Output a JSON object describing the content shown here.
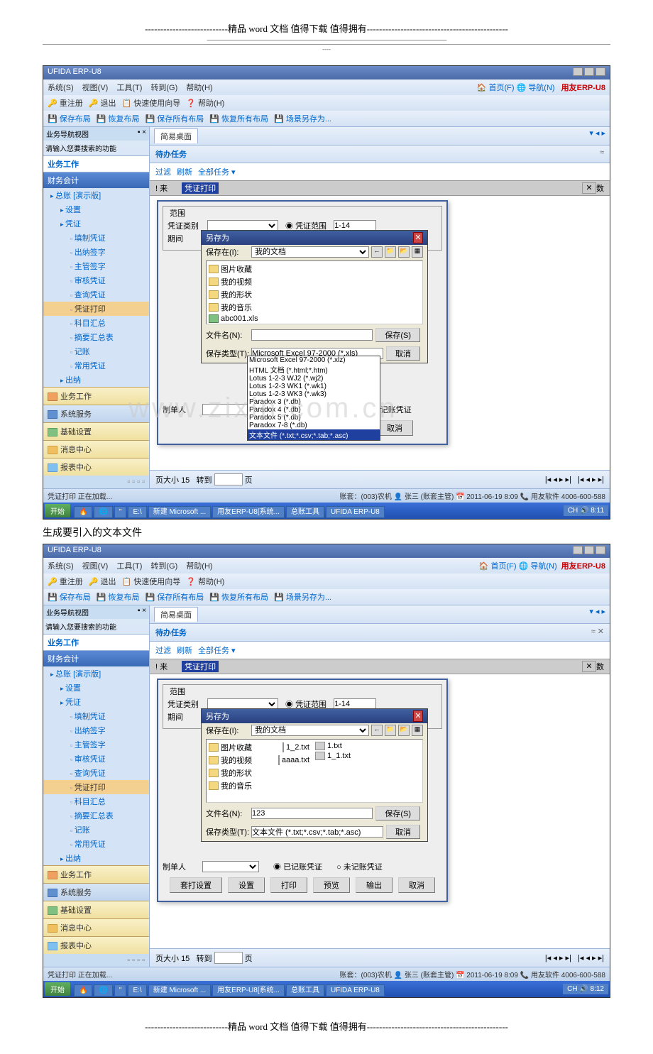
{
  "page_header": {
    "sep": "---------------------------精品 word 文档  值得下载  值得拥有----------------------------------------------",
    "dash": "-------------------------------------------------------------------------------------------------------------------------------------------------------------------------",
    "dash2": "----"
  },
  "caption": "生成要引入的文本文件",
  "watermark": "www.zixin.com.cn",
  "page_footer": {
    "sep": "---------------------------精品 word 文档  值得下载  值得拥有----------------------------------------------"
  },
  "erp": {
    "title": "UFIDA ERP-U8",
    "menu": [
      "系统(S)",
      "视图(V)",
      "工具(T)",
      "转到(G)",
      "帮助(H)"
    ],
    "menu_right": {
      "home": "首页(F)",
      "nav": "导航(N)",
      "logo": "用友ERP-U8"
    },
    "tb1": [
      "重注册",
      "退出",
      "快速使用向导",
      "帮助(H)"
    ],
    "tb2": [
      "保存布局",
      "恢复布局",
      "保存所有布局",
      "恢复所有布局",
      "场景另存为..."
    ],
    "side": {
      "nav_label": "业务导航视图",
      "search_hint": "请输入您要搜索的功能",
      "work": "业务工作",
      "group": "财务会计",
      "tree": [
        {
          "l": "l1",
          "t": "总账 [演示版]",
          "leaf": false
        },
        {
          "l": "l2",
          "t": "设置",
          "leaf": false
        },
        {
          "l": "l2",
          "t": "凭证",
          "leaf": false
        },
        {
          "l": "l3",
          "t": "填制凭证",
          "leaf": true
        },
        {
          "l": "l3",
          "t": "出纳签字",
          "leaf": true
        },
        {
          "l": "l3",
          "t": "主管签字",
          "leaf": true
        },
        {
          "l": "l3",
          "t": "审核凭证",
          "leaf": true
        },
        {
          "l": "l3",
          "t": "查询凭证",
          "leaf": true
        },
        {
          "l": "l3",
          "t": "凭证打印",
          "leaf": true,
          "sel": true
        },
        {
          "l": "l3",
          "t": "科目汇总",
          "leaf": true
        },
        {
          "l": "l3",
          "t": "摘要汇总表",
          "leaf": true
        },
        {
          "l": "l3",
          "t": "记账",
          "leaf": true
        },
        {
          "l": "l3",
          "t": "常用凭证",
          "leaf": true
        },
        {
          "l": "l2",
          "t": "出纳",
          "leaf": false
        }
      ],
      "cats": [
        "业务工作",
        "系统服务",
        "基础设置",
        "消息中心",
        "报表中心"
      ]
    },
    "tabs": {
      "main": "简易桌面"
    },
    "task": {
      "title": "待办任务",
      "btns": "≈",
      "filter": [
        "过滤",
        "刷新",
        "全部任务 ▾"
      ]
    },
    "row": {
      "c1": "! 来",
      "c2": "凭证打印",
      "c3": "数"
    },
    "pz_dlg": {
      "title": "凭证打印",
      "range": "范围",
      "type": "凭证类别",
      "range2": "凭证范围",
      "range2_val": "1-14",
      "period": "期间",
      "maker": "制单人",
      "recorded": "已记账凭证",
      "unrecorded": "未记账凭证",
      "btns": [
        "套打设置",
        "设置",
        "打印",
        "预览",
        "输出",
        "取消"
      ]
    },
    "save_dlg": {
      "title": "另存为",
      "in": "保存在(I):",
      "in_val": "我的文档",
      "files1": [
        {
          "i": "",
          "n": "图片收藏"
        },
        {
          "i": "",
          "n": "我的视频"
        },
        {
          "i": "",
          "n": "我的形状"
        },
        {
          "i": "",
          "n": "我的音乐"
        },
        {
          "i": "xls",
          "n": "abc001.xls"
        }
      ],
      "files2": [
        {
          "i": "",
          "n": "图片收藏",
          "n2": "1_2.txt"
        },
        {
          "i": "",
          "n": "我的视频",
          "n2": "aaaa.txt"
        },
        {
          "i": "",
          "n": "我的形状"
        },
        {
          "i": "",
          "n": "我的音乐"
        },
        {
          "i": "txt",
          "n": "1.txt"
        },
        {
          "i": "txt",
          "n": "1_1.txt"
        }
      ],
      "fname": "文件名(N):",
      "fname_val": "123",
      "ftype": "保存类型(T):",
      "ftype_val": "Microsoft Excel 97-2000 (*.xls)",
      "ftype_val2": "文本文件 (*.txt;*.csv;*.tab;*.asc)",
      "typelist": [
        "Microsoft Excel 97-2000 (*.xlz)",
        "HTML 文档 (*.html;*.htm)",
        "Lotus 1-2-3 WJ2 (*.wj2)",
        "Lotus 1-2-3 WK1 (*.wk1)",
        "Lotus 1-2-3 WK3 (*.wk3)",
        "Paradox 3 (*.db)",
        "Paradox 4 (*.db)",
        "Paradox 5 (*.db)",
        "Paradox 7-8 (*.db)",
        "文本文件 (*.txt;*.csv;*.tab;*.asc)"
      ],
      "save": "保存(S)",
      "cancel": "取消"
    },
    "page": {
      "size": "页大小",
      "size_v": "15",
      "goto": "转到",
      "page": "页"
    },
    "status": {
      "left": "凭证打印 正在加载...",
      "right": "账套：(003)农机 👤 张三 (账套主管) 📅 2011-06-19 8:09 📞 用友软件  4006-600-588"
    },
    "win": {
      "start": "开始",
      "items": [
        "🔥",
        "🌐",
        "\"",
        "E:\\",
        "新建 Microsoft ...",
        "用友ERP-U8[系统...",
        "总账工具",
        "UFIDA ERP-U8"
      ],
      "tray": "CH 🔊 8:11",
      "tray2": "CH 🔊 8:12"
    }
  }
}
